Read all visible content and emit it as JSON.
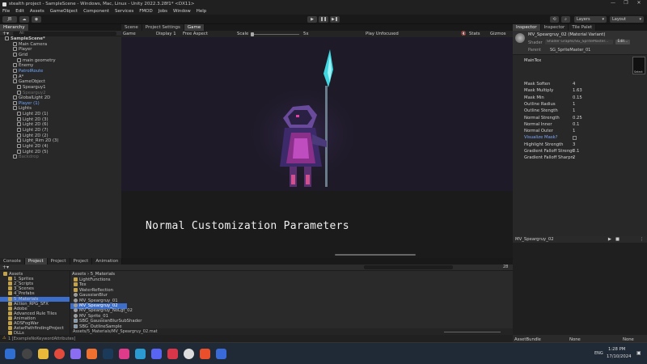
{
  "window": {
    "title": "stealth project - SampleScene - Windows, Mac, Linux - Unity 2022.3.28f1* <DX11>",
    "controls": [
      "—",
      "❐",
      "✕"
    ]
  },
  "menu": [
    "File",
    "Edit",
    "Assets",
    "GameObject",
    "Component",
    "Services",
    "FMOD",
    "Jobs",
    "Window",
    "Help"
  ],
  "toolbar": {
    "account_label": "JB",
    "layers_label": "Layers",
    "layout_label": "Layout"
  },
  "hierarchy": {
    "tab": "Hierarchy",
    "search": "All",
    "items": [
      {
        "label": "SampleScene*",
        "depth": 0,
        "style": "bold"
      },
      {
        "label": "Main Camera",
        "depth": 2,
        "style": ""
      },
      {
        "label": "Player",
        "depth": 2,
        "style": ""
      },
      {
        "label": "Grid",
        "depth": 2,
        "style": ""
      },
      {
        "label": "main geometry",
        "depth": 3,
        "style": ""
      },
      {
        "label": "Enemy",
        "depth": 2,
        "style": ""
      },
      {
        "label": "PatrolRoute",
        "depth": 2,
        "style": "blue"
      },
      {
        "label": "A*",
        "depth": 2,
        "style": ""
      },
      {
        "label": "GameObject",
        "depth": 2,
        "style": ""
      },
      {
        "label": "Spearguy1",
        "depth": 3,
        "style": ""
      },
      {
        "label": "Spearguy2",
        "depth": 3,
        "style": "dim"
      },
      {
        "label": "GlobalLight 2D",
        "depth": 2,
        "style": ""
      },
      {
        "label": "Player (1)",
        "depth": 2,
        "style": "blue"
      },
      {
        "label": "Lights",
        "depth": 2,
        "style": ""
      },
      {
        "label": "Light 2D (1)",
        "depth": 3,
        "style": ""
      },
      {
        "label": "Light 2D (3)",
        "depth": 3,
        "style": ""
      },
      {
        "label": "Light 2D (6)",
        "depth": 3,
        "style": ""
      },
      {
        "label": "Light 2D (7)",
        "depth": 3,
        "style": ""
      },
      {
        "label": "Light 2D (2)",
        "depth": 3,
        "style": ""
      },
      {
        "label": "Light_Rim 2D (3)",
        "depth": 3,
        "style": ""
      },
      {
        "label": "Light 2D (4)",
        "depth": 3,
        "style": ""
      },
      {
        "label": "Light 2D (5)",
        "depth": 3,
        "style": ""
      },
      {
        "label": "Backdrop",
        "depth": 2,
        "style": "dim"
      }
    ]
  },
  "scene_tabs": [
    "Scene",
    "Project Settings",
    "Game"
  ],
  "game_bar": {
    "mode": "Game",
    "display": "Display 1",
    "aspect": "Free Aspect",
    "scale_label": "Scale",
    "scale_value": "5x",
    "play_mode": "Play Unfocused",
    "stats": "Stats",
    "gizmos": "Gizmos"
  },
  "caption": "Normal Customization Parameters",
  "inspector": {
    "tabs": [
      "Inspector",
      "Inspector",
      "Tile Palet"
    ],
    "material_name": "MV_Speargruy_02 (Material Variant)",
    "shader_label": "Shader",
    "shader_value": "Shader Graphs/SG_SpriteMaster...",
    "edit_label": "Edit...",
    "parent_label": "Parent",
    "parent_value": "SG_SpriteMaster_01",
    "maintex_label": "MainTex",
    "select_label": "Select",
    "properties": [
      {
        "name": "Mask Soften",
        "value": "4"
      },
      {
        "name": "Mask Multiply",
        "value": "1.63"
      },
      {
        "name": "Mask Min",
        "value": "0.15"
      },
      {
        "name": "Outline Radius",
        "value": "1"
      },
      {
        "name": "Outline Stength",
        "value": "1"
      },
      {
        "name": "Normal Strength",
        "value": "0.25"
      },
      {
        "name": "Normal Inner",
        "value": "0.1"
      },
      {
        "name": "Normal Outer",
        "value": "1"
      },
      {
        "name": "Visualize Mask?",
        "value": ""
      },
      {
        "name": "Highlight Strength",
        "value": "3"
      },
      {
        "name": "Gradient Falloff Strengt",
        "value": "0.1"
      },
      {
        "name": "Gradient Falloff Sharpn",
        "value": "2"
      }
    ]
  },
  "preview": {
    "title": "MV_Speargruy_02"
  },
  "bottom_tabs": [
    "Console",
    "Project",
    "Project",
    "Project",
    "Animation"
  ],
  "project": {
    "breadcrumb": [
      "Assets",
      "5_Materials"
    ],
    "count_label": "28",
    "tree": [
      {
        "label": "Assets",
        "depth": 0
      },
      {
        "label": "1_Sprites",
        "depth": 1
      },
      {
        "label": "2_Scripts",
        "depth": 1
      },
      {
        "label": "3_Scenes",
        "depth": 1
      },
      {
        "label": "4_Prefabs",
        "depth": 1
      },
      {
        "label": "5_Materials",
        "depth": 1
      },
      {
        "label": "Action_RPG_SFX",
        "depth": 1
      },
      {
        "label": "Adobe",
        "depth": 1
      },
      {
        "label": "Advanced Rule Tiles",
        "depth": 1
      },
      {
        "label": "Animation",
        "depth": 1
      },
      {
        "label": "AOSFogWar",
        "depth": 1
      },
      {
        "label": "AstarPathfindingProject",
        "depth": 1
      },
      {
        "label": "DLLs",
        "depth": 1
      }
    ],
    "files": [
      {
        "label": "LightFunctions",
        "kind": "folder"
      },
      {
        "label": "Tex",
        "kind": "folder"
      },
      {
        "label": "WaterReflection",
        "kind": "folder"
      },
      {
        "label": "GaussianBlur",
        "kind": "mat"
      },
      {
        "label": "MV_Speargruy_01",
        "kind": "mat"
      },
      {
        "label": "MV_Speargruy_02",
        "kind": "mat-selected"
      },
      {
        "label": "MV_Speargruy_NoLgt_02",
        "kind": "mat"
      },
      {
        "label": "MV_Sprite_01",
        "kind": "mat"
      },
      {
        "label": "SBG_GaussianBlurSubShader",
        "kind": "shader"
      },
      {
        "label": "SBG_OutlineSample",
        "kind": "shader"
      },
      {
        "label": "SBG_SpriteMaster",
        "kind": "shader"
      }
    ],
    "path_bar": "Assets/5_Materials/MV_Speargruy_02.mat"
  },
  "asset_bundle": {
    "label": "AssetBundle",
    "value": "None",
    "variant": "None"
  },
  "statusbar": {
    "message": "1 [ExampleNoKeywordAttributes]"
  },
  "taskbar": {
    "lang": "ENG",
    "time": "1:28 PM",
    "date": "17/10/2024"
  },
  "colors": {
    "accent_blue": "#3d6ec9",
    "panel": "#282828",
    "game_bg": "#1e1a27"
  }
}
